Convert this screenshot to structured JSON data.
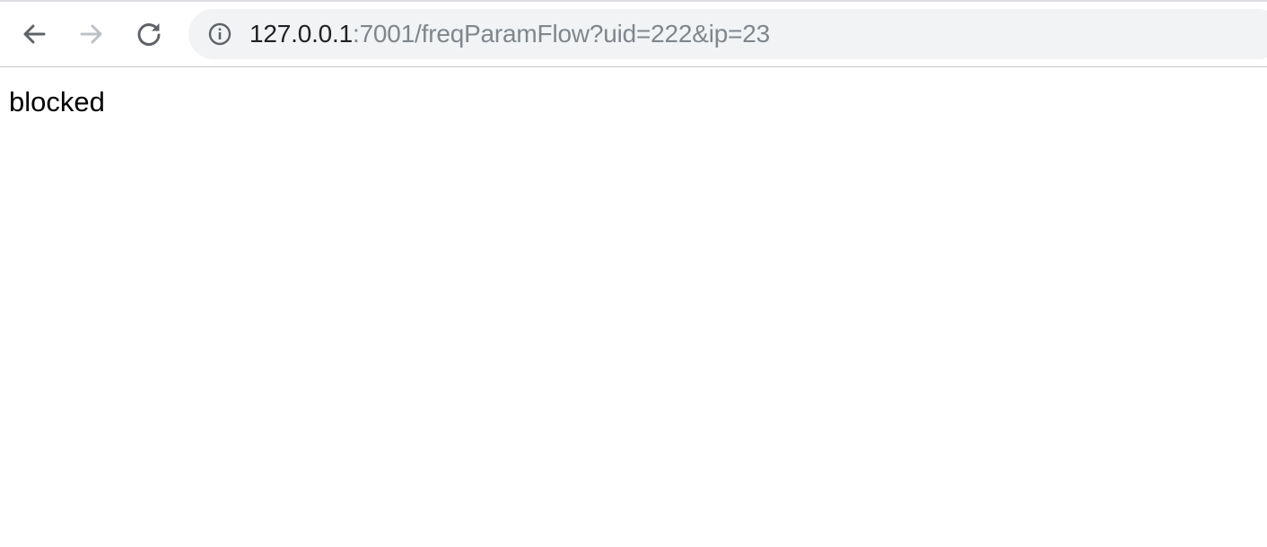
{
  "browser": {
    "address_bar": {
      "url_host": "127.0.0.1",
      "url_rest": ":7001/freqParamFlow?uid=222&ip=23"
    },
    "icons": {
      "back": "arrow-left-icon",
      "forward": "arrow-right-icon",
      "reload": "reload-icon",
      "site_info": "info-icon"
    },
    "colors": {
      "icon_active": "#5f6368",
      "icon_disabled": "#bdc1c6",
      "omnibox_bg": "#f1f3f4"
    }
  },
  "page": {
    "body_text": "blocked"
  }
}
